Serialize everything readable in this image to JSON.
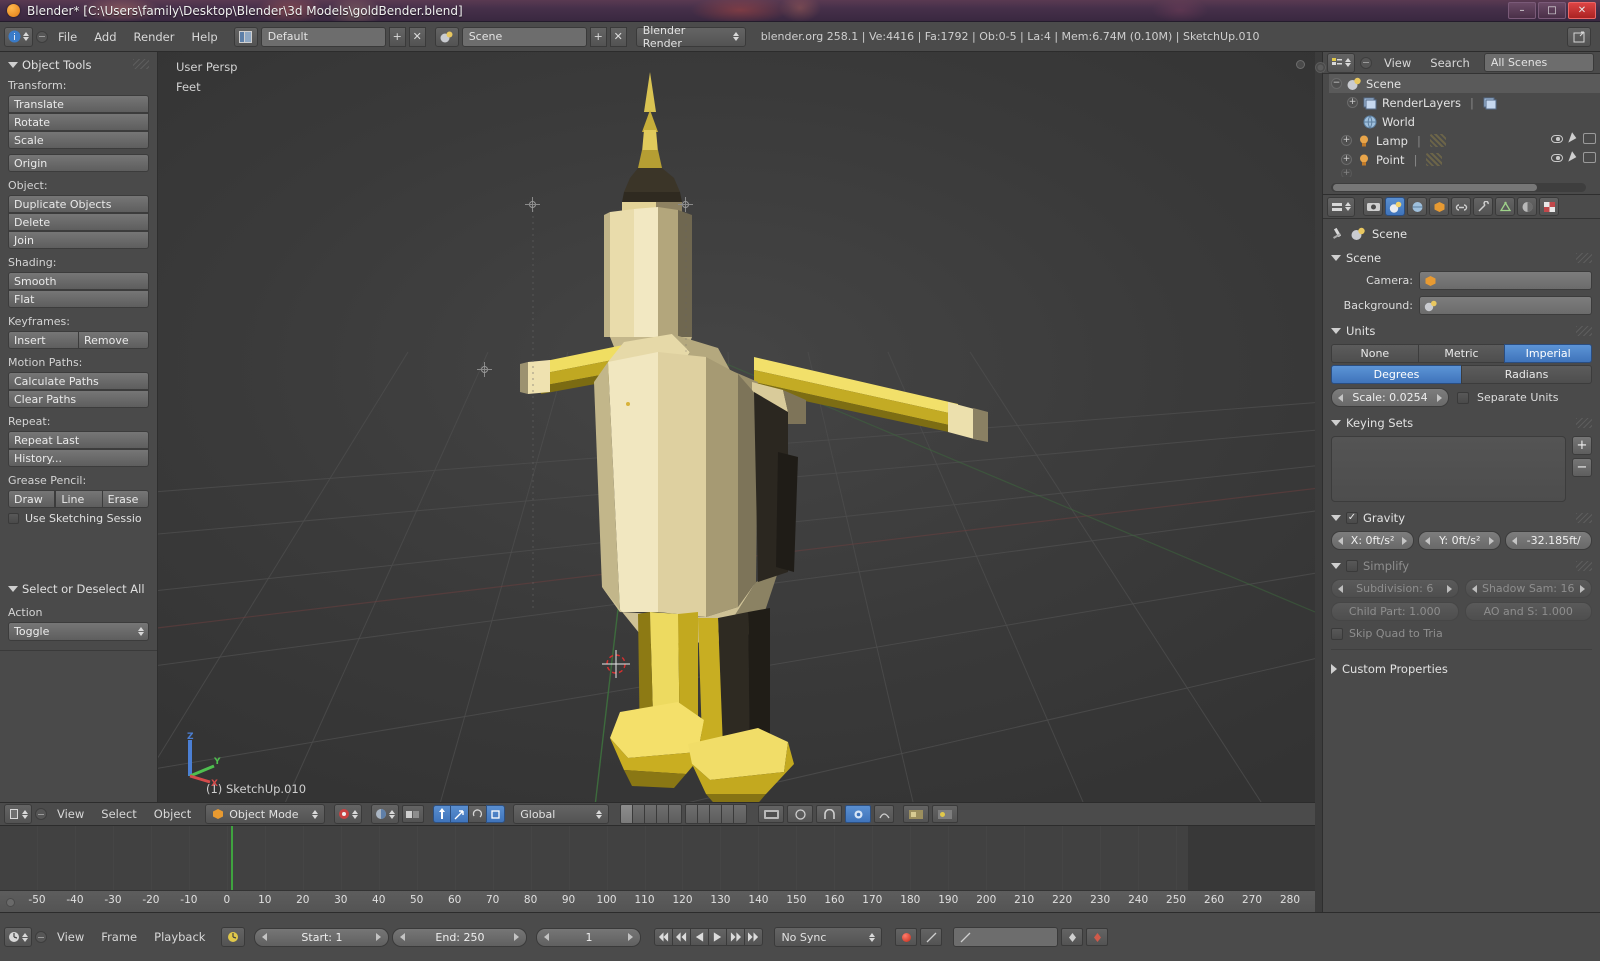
{
  "titlebar": {
    "title": "Blender* [C:\\Users\\family\\Desktop\\Blender\\3d Models\\goldBender.blend]",
    "icon": "blender-logo-icon",
    "minimize": "–",
    "maximize": "□",
    "close": "✕"
  },
  "topbar": {
    "info_icon": "info-editor-icon",
    "menus": [
      "File",
      "Add",
      "Render",
      "Help"
    ],
    "screen_layout": "Default",
    "scene_name": "Scene",
    "engine": "Blender Render",
    "status": "blender.org 258.1 | Ve:4416 | Fa:1792 | Ob:0-5 | La:4 | Mem:6.74M (0.10M) | SketchUp.010",
    "add_label": "+",
    "remove_label": "✕"
  },
  "toolshelf": {
    "panel_title": "Object Tools",
    "groups": [
      {
        "label": "Transform:",
        "buttons": [
          "Translate",
          "Rotate",
          "Scale"
        ]
      },
      {
        "label": "",
        "buttons": [
          "Origin"
        ]
      },
      {
        "label": "Object:",
        "buttons": [
          "Duplicate Objects",
          "Delete",
          "Join"
        ]
      },
      {
        "label": "Shading:",
        "buttons": [
          "Smooth",
          "Flat"
        ]
      }
    ],
    "keyframes_label": "Keyframes:",
    "keyframes_buttons": [
      "Insert",
      "Remove"
    ],
    "motion_paths_label": "Motion Paths:",
    "motion_paths_buttons": [
      "Calculate Paths",
      "Clear Paths"
    ],
    "repeat_label": "Repeat:",
    "repeat_buttons": [
      "Repeat Last",
      "History..."
    ],
    "grease_label": "Grease Pencil:",
    "grease_buttons": [
      "Draw",
      "Line",
      "Erase"
    ],
    "sketching_checkbox": "Use Sketching Sessio",
    "select_panel_title": "Select or Deselect All",
    "action_label": "Action",
    "action_value": "Toggle"
  },
  "viewport": {
    "view_mode": "User Persp",
    "units_label": "Feet",
    "object_label": "(1) SketchUp.010",
    "gizmo": {
      "z": "Z",
      "y": "Y",
      "x": "X"
    }
  },
  "vpheader": {
    "editor_icon": "editor-type-icon",
    "menus": [
      "View",
      "Select",
      "Object"
    ],
    "mode": "Object Mode",
    "transform_orientation": "Global",
    "icons": [
      "viewport-shading-icon",
      "pivot-point-icon",
      "snap-magnet-icon",
      "proportional-edit-icon",
      "manipulator-translate-icon",
      "manipulator-rotate-icon",
      "manipulator-scale-icon",
      "render-opengl-icon",
      "lock-camera-icon"
    ]
  },
  "timeline": {
    "ticks": [
      "-50",
      "-40",
      "-30",
      "-20",
      "-10",
      "0",
      "10",
      "20",
      "30",
      "40",
      "50",
      "60",
      "70",
      "80",
      "90",
      "100",
      "110",
      "120",
      "130",
      "140",
      "150",
      "160",
      "170",
      "180",
      "190",
      "200",
      "210",
      "220",
      "230",
      "240",
      "250",
      "260",
      "270",
      "280"
    ],
    "current_frame_marker": 0
  },
  "playbar": {
    "editor_icon": "timeline-editor-icon",
    "menus": [
      "View",
      "Frame",
      "Playback"
    ],
    "start_label": "Start: 1",
    "end_label": "End: 250",
    "current_frame": "1",
    "sync_mode": "No Sync",
    "transport": [
      "jump-start-icon",
      "play-reverse-icon",
      "play-icon",
      "jump-end-icon",
      "prev-keyframe-icon",
      "next-keyframe-icon"
    ],
    "record_icon": "record-icon",
    "autokey_icon": "autokey-icon"
  },
  "outliner": {
    "display_mode_icon": "outliner-display-icon",
    "menus": [
      "View",
      "Search"
    ],
    "scope": "All Scenes",
    "rows": [
      {
        "label": "Scene",
        "icon": "scene-icon",
        "indent": 0,
        "expander": "−",
        "selected": true,
        "controls": false
      },
      {
        "label": "RenderLayers",
        "icon": "renderlayers-icon",
        "indent": 1,
        "expander": "+",
        "selected": false,
        "controls": false
      },
      {
        "label": "World",
        "icon": "world-icon",
        "indent": 1,
        "expander": "",
        "selected": false,
        "controls": false
      },
      {
        "label": "Lamp",
        "icon": "lamp-icon",
        "indent": 1,
        "expander": "+",
        "selected": false,
        "controls": true
      },
      {
        "label": "Point",
        "icon": "lamp-icon",
        "indent": 1,
        "expander": "+",
        "selected": false,
        "controls": true
      }
    ]
  },
  "properties": {
    "tabs": [
      "render-tab-icon",
      "scene-tab-icon",
      "world-tab-icon",
      "object-tab-icon",
      "constraints-tab-icon",
      "modifiers-tab-icon",
      "data-tab-icon",
      "material-tab-icon",
      "texture-tab-icon"
    ],
    "active_tab_index": 1,
    "breadcrumb": "Scene",
    "scene_section": "Scene",
    "camera_label": "Camera:",
    "camera_value": "",
    "background_label": "Background:",
    "background_value": "",
    "units_section": "Units",
    "unit_systems": [
      "None",
      "Metric",
      "Imperial"
    ],
    "unit_system_active": "Imperial",
    "rotation_units": [
      "Degrees",
      "Radians"
    ],
    "rotation_active": "Degrees",
    "scale_label": "Scale: 0.0254",
    "separate_units": "Separate Units",
    "keying_sets_section": "Keying Sets",
    "add_button": "+",
    "remove_button": "−",
    "gravity_section": "Gravity",
    "gravity_enabled": true,
    "gravity_x": "X: 0ft/s²",
    "gravity_y": "Y: 0ft/s²",
    "gravity_z": "-32.185ft/",
    "simplify_section": "Simplify",
    "simplify_enabled": false,
    "subdivision": "Subdivision: 6",
    "shadow_samples": "Shadow Sam: 16",
    "child_particles": "Child Part: 1.000",
    "ao_ssao": "AO and S: 1.000",
    "skip_quad": "Skip Quad to Tria",
    "custom_properties": "Custom Properties"
  },
  "colors": {
    "accent_blue": "#3f74bb",
    "panel_bg": "#4a4a4a",
    "header_bg": "#4b4b4b",
    "viewport_bg": "#3b3b3b",
    "gold_light": "#e8d78c",
    "gold_dark": "#c9a227",
    "axis_z": "#4b7fd4",
    "axis_y": "#4fbf4f",
    "axis_x": "#d44b4b"
  }
}
